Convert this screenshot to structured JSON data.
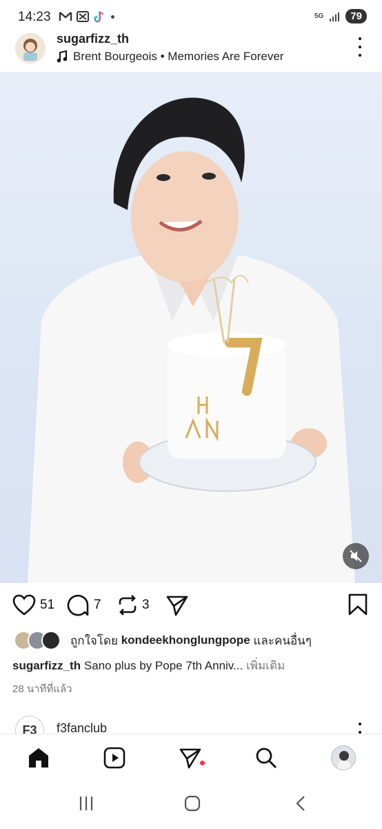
{
  "status_bar": {
    "time": "14:23",
    "network": "5G",
    "battery": "79"
  },
  "post": {
    "username": "sugarfizz_th",
    "music": "Brent Bourgeois • Memories Are Forever",
    "image_alt": "HAPPY ANNIVERSARY cake with 7 candle",
    "likes": "51",
    "comments": "7",
    "reposts": "3",
    "liked_by_prefix": "ถูกใจโดย",
    "liked_by_user": "kondeekhonglungpope",
    "liked_by_suffix": "และคนอื่นๆ",
    "caption_user": "sugarfizz_th",
    "caption_text": "Sano plus by Pope 7th Anniv...",
    "more_label": "เพิ่มเติม",
    "time_ago": "28 นาทีที่แล้ว"
  },
  "next_post": {
    "username": "f3fanclub",
    "avatar_text": "F3"
  },
  "colors": {
    "notification_dot": "#ff3040",
    "background": "#ffffff"
  },
  "icons": [
    "heart-icon",
    "comment-icon",
    "repost-icon",
    "share-icon",
    "bookmark-icon",
    "mute-icon",
    "home-icon",
    "reels-icon",
    "direct-icon",
    "search-icon",
    "music-note-icon"
  ]
}
